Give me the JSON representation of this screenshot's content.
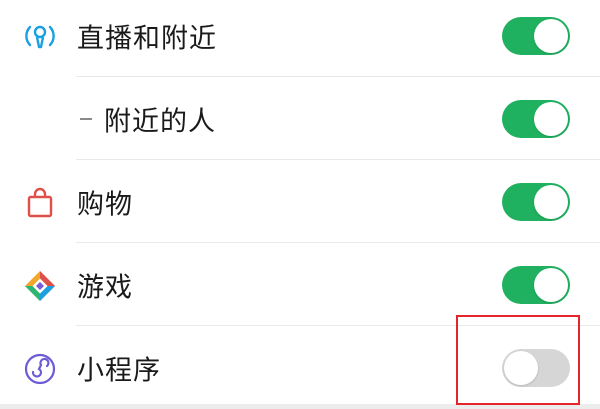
{
  "rows": [
    {
      "label": "直播和附近",
      "icon": "live-broadcast-icon",
      "enabled": true
    },
    {
      "label": "附近的人",
      "icon": null,
      "enabled": true,
      "sub": true
    },
    {
      "label": "购物",
      "icon": "shopping-bag-icon",
      "enabled": true
    },
    {
      "label": "游戏",
      "icon": "game-diamond-icon",
      "enabled": true
    },
    {
      "label": "小程序",
      "icon": "mini-program-icon",
      "enabled": false
    }
  ],
  "colors": {
    "toggle_on": "#1fb15f",
    "toggle_off": "#d6d6d6",
    "highlight_border": "#e2262b",
    "live_icon": "#1aa0e0",
    "shopping_icon": "#e0504a",
    "mini_program_icon": "#6b5bd6"
  },
  "annotation": {
    "highlight": "red-rectangle around mini-program toggle"
  }
}
